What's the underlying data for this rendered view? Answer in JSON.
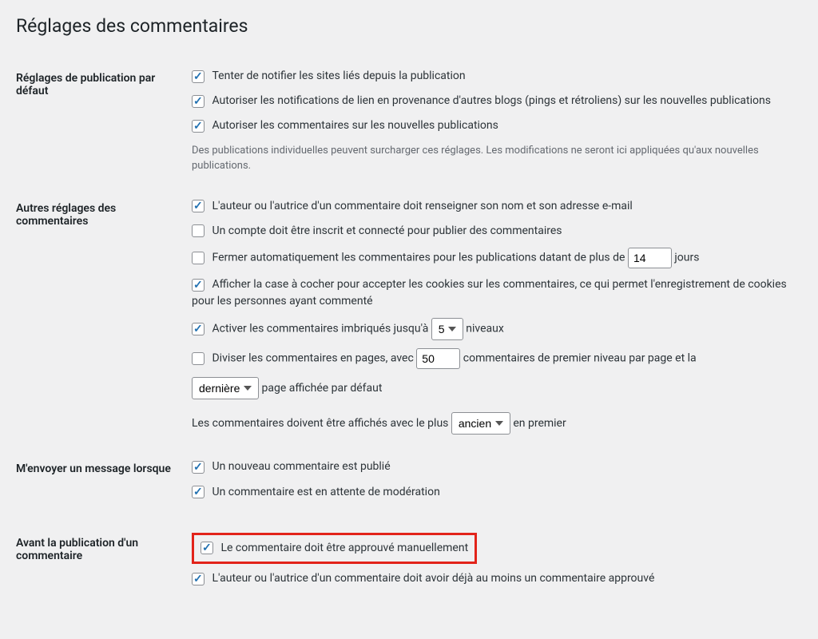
{
  "page_title": "Réglages des commentaires",
  "sections": {
    "default_post": {
      "heading": "Réglages de publication par défaut",
      "opt_pingback": "Tenter de notifier les sites liés depuis la publication",
      "opt_ping_receive": "Autoriser les notifications de lien en provenance d'autres blogs (pings et rétroliens) sur les nouvelles publications",
      "opt_allow_comments": "Autoriser les commentaires sur les nouvelles publications",
      "description": "Des publications individuelles peuvent surcharger ces réglages. Les modifications ne seront ici appliquées qu'aux nouvelles publications."
    },
    "other": {
      "heading": "Autres réglages des commentaires",
      "opt_name_email": "L'auteur ou l'autrice d'un commentaire doit renseigner son nom et son adresse e-mail",
      "opt_registered": "Un compte doit être inscrit et connecté pour publier des commentaires",
      "opt_close_before": "Fermer automatiquement les commentaires pour les publications datant de plus de ",
      "opt_close_days_value": "14",
      "opt_close_after": " jours",
      "opt_cookies": "Afficher la case à cocher pour accepter les cookies sur les commentaires, ce qui permet l'enregistrement de cookies pour les personnes ayant commenté",
      "opt_threaded_before": "Activer les commentaires imbriqués jusqu'à ",
      "opt_threaded_value": "5",
      "opt_threaded_after": " niveaux",
      "opt_paginate_before": "Diviser les commentaires en pages, avec ",
      "opt_paginate_value": "50",
      "opt_paginate_after": " commentaires de premier niveau par page et la",
      "opt_page_sel_value": "dernière",
      "opt_page_sel_after": " page affichée par défaut",
      "opt_order_before": "Les commentaires doivent être affichés avec le plus ",
      "opt_order_value": "ancien",
      "opt_order_after": " en premier"
    },
    "email_me": {
      "heading": "M'envoyer un message lorsque",
      "opt_new_comment": "Un nouveau commentaire est publié",
      "opt_held": "Un commentaire est en attente de modération"
    },
    "before_appear": {
      "heading": "Avant la publication d'un commentaire",
      "opt_manual": "Le commentaire doit être approuvé manuellement",
      "opt_previous": "L'auteur ou l'autrice d'un commentaire doit avoir déjà au moins un commentaire approuvé"
    }
  }
}
